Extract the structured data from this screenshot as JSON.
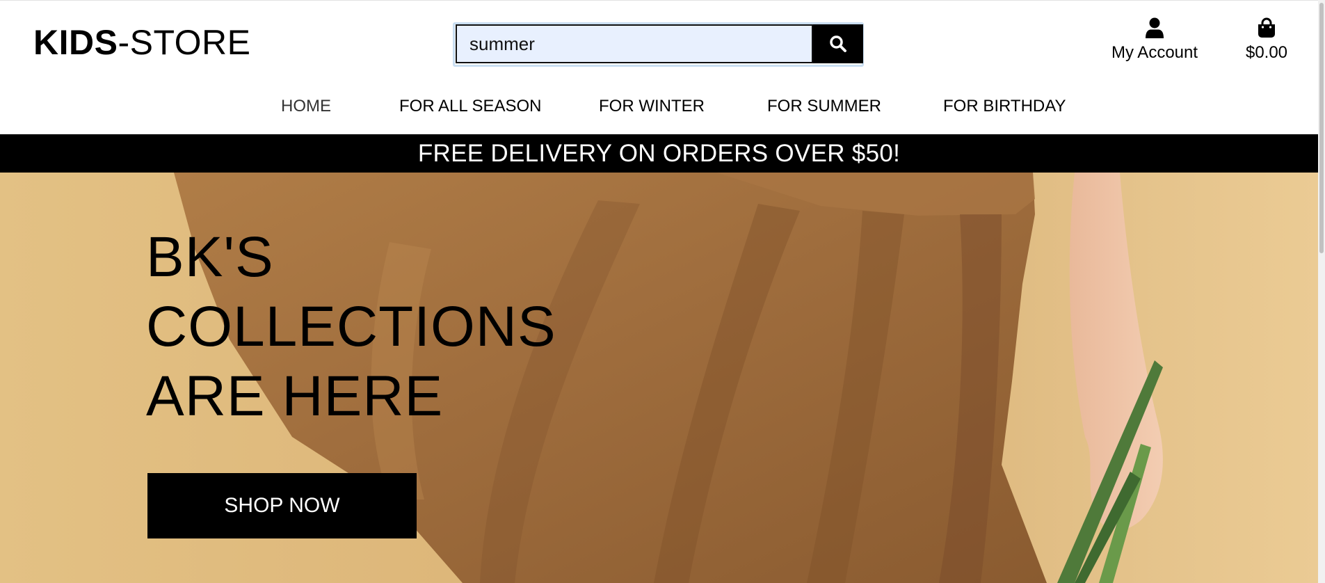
{
  "header": {
    "logo_bold": "KIDS",
    "logo_light": "-STORE",
    "search": {
      "value": "summer",
      "placeholder": ""
    },
    "account_label": "My Account",
    "cart_total": "$0.00"
  },
  "nav": {
    "items": [
      {
        "label": "HOME"
      },
      {
        "label": "FOR ALL SEASON"
      },
      {
        "label": "FOR WINTER"
      },
      {
        "label": "FOR SUMMER"
      },
      {
        "label": "FOR BIRTHDAY"
      }
    ]
  },
  "banner": {
    "text": "FREE DELIVERY ON ORDERS OVER $50!"
  },
  "hero": {
    "title_lines": [
      "BK'S",
      "COLLECTIONS",
      "ARE HERE"
    ],
    "button_label": "SHOP NOW"
  },
  "icons": {
    "search": "search-icon",
    "account": "user-icon",
    "cart": "shopping-bag-icon"
  },
  "colors": {
    "primary": "#000000",
    "search_bg": "#e8f0fe",
    "hero_bg": "#deb87b",
    "dress": "#9c6b3c"
  }
}
